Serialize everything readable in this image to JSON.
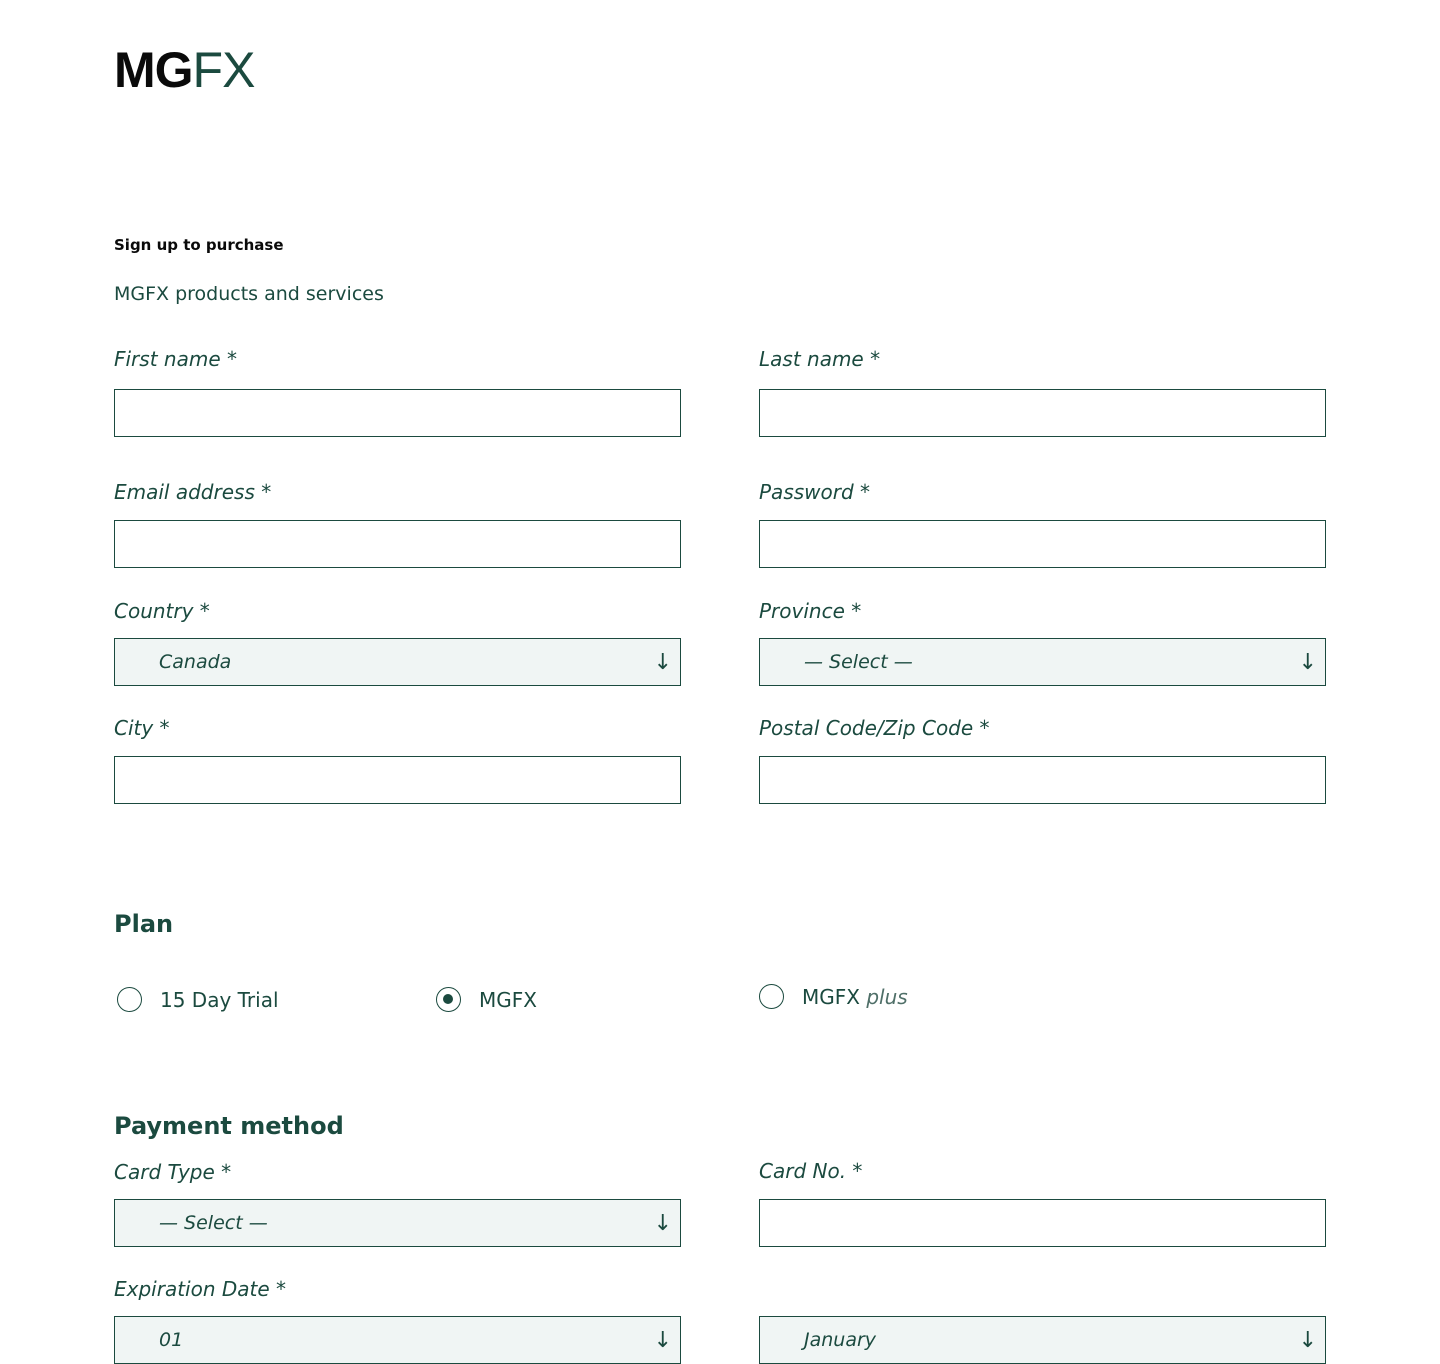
{
  "brand": {
    "logo_bold": "MG",
    "logo_light": "FX",
    "accent_color": "#1b4a3f"
  },
  "header": {
    "eyebrow": "Sign up to purchase",
    "subtitle": "MGFX products and services"
  },
  "form": {
    "first_name": {
      "label": "First name *",
      "value": ""
    },
    "last_name": {
      "label": "Last name *",
      "value": ""
    },
    "email": {
      "label": "Email address *",
      "value": ""
    },
    "password": {
      "label": "Password *",
      "value": ""
    },
    "country": {
      "label": "Country *",
      "selected": "Canada"
    },
    "province": {
      "label": "Province *",
      "selected": "— Select —"
    },
    "city": {
      "label": "City *",
      "value": ""
    },
    "postal": {
      "label": "Postal Code/Zip Code *",
      "value": ""
    }
  },
  "plan": {
    "title": "Plan",
    "options": [
      {
        "label": "15 Day Trial",
        "checked": false
      },
      {
        "label": "MGFX",
        "checked": true
      },
      {
        "label": "MGFX",
        "suffix": "plus",
        "checked": false
      }
    ]
  },
  "payment": {
    "title": "Payment method",
    "card_type": {
      "label": "Card Type *",
      "selected": "— Select —"
    },
    "card_no": {
      "label": "Card No. *",
      "value": ""
    },
    "expiration": {
      "label": "Expiration Date *",
      "day_selected": "01",
      "month_selected": "January"
    }
  },
  "icons": {
    "select_arrow": "arrow-down-icon"
  }
}
